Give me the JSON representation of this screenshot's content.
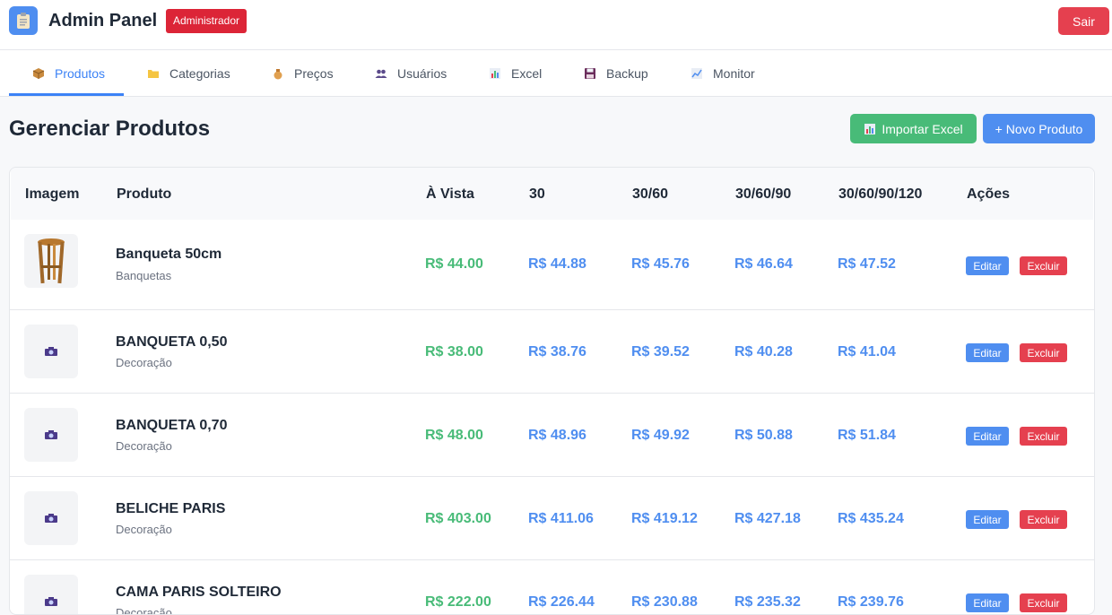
{
  "header": {
    "title": "Admin Panel",
    "role_badge": "Administrador",
    "logout_label": "Sair"
  },
  "tabs": [
    {
      "label": "Produtos",
      "icon": "box-icon",
      "active": true
    },
    {
      "label": "Categorias",
      "icon": "folder-icon",
      "active": false
    },
    {
      "label": "Preços",
      "icon": "money-bag-icon",
      "active": false
    },
    {
      "label": "Usuários",
      "icon": "users-icon",
      "active": false
    },
    {
      "label": "Excel",
      "icon": "bar-chart-icon",
      "active": false
    },
    {
      "label": "Backup",
      "icon": "floppy-disk-icon",
      "active": false
    },
    {
      "label": "Monitor",
      "icon": "line-chart-icon",
      "active": false
    }
  ],
  "main": {
    "title": "Gerenciar Produtos",
    "import_label": "Importar Excel",
    "new_label": "+ Novo Produto"
  },
  "table": {
    "columns": [
      "Imagem",
      "Produto",
      "À Vista",
      "30",
      "30/60",
      "30/60/90",
      "30/60/90/120",
      "Ações"
    ],
    "edit_label": "Editar",
    "delete_label": "Excluir",
    "rows": [
      {
        "name": "Banqueta 50cm",
        "category": "Banquetas",
        "image": "stool-photo",
        "prices": [
          "R$ 44.00",
          "R$ 44.88",
          "R$ 45.76",
          "R$ 46.64",
          "R$ 47.52"
        ]
      },
      {
        "name": "BANQUETA 0,50",
        "category": "Decoração",
        "image": "camera-icon",
        "prices": [
          "R$ 38.00",
          "R$ 38.76",
          "R$ 39.52",
          "R$ 40.28",
          "R$ 41.04"
        ]
      },
      {
        "name": "BANQUETA 0,70",
        "category": "Decoração",
        "image": "camera-icon",
        "prices": [
          "R$ 48.00",
          "R$ 48.96",
          "R$ 49.92",
          "R$ 50.88",
          "R$ 51.84"
        ]
      },
      {
        "name": "BELICHE PARIS",
        "category": "Decoração",
        "image": "camera-icon",
        "prices": [
          "R$ 403.00",
          "R$ 411.06",
          "R$ 419.12",
          "R$ 427.18",
          "R$ 435.24"
        ]
      },
      {
        "name": "CAMA PARIS SOLTEIRO",
        "category": "Decoração",
        "image": "camera-icon",
        "prices": [
          "R$ 222.00",
          "R$ 226.44",
          "R$ 230.88",
          "R$ 235.32",
          "R$ 239.76"
        ]
      }
    ]
  },
  "colors": {
    "primary": "#4f8ef0",
    "success": "#48bb78",
    "danger": "#e5404f",
    "badge": "#dc2537"
  }
}
